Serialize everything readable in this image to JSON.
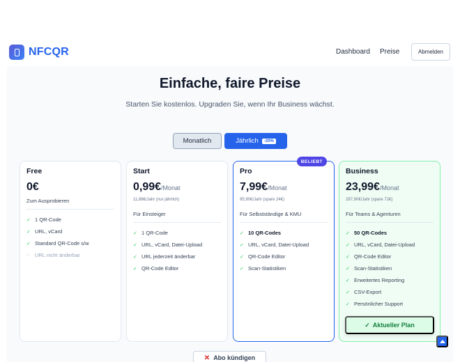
{
  "app": {
    "logo_text": "NFCQR"
  },
  "nav": {
    "dashboard": "Dashboard",
    "preise": "Preise",
    "logout": "Abmelden"
  },
  "hero": {
    "title": "Einfache, faire Preise",
    "subtitle": "Starten Sie kostenlos. Upgraden Sie, wenn Ihr Business wächst."
  },
  "billing": {
    "monthly": "Monatlich",
    "yearly": "Jährlich",
    "discount": "-20%",
    "selected": "yearly"
  },
  "plans": [
    {
      "name": "Free",
      "price": "0€",
      "period": "",
      "yearly_note": "",
      "desc": "Zum Ausprobieren",
      "features": [
        {
          "text": "1 QR-Code",
          "included": true
        },
        {
          "text": "URL, vCard",
          "included": true
        },
        {
          "text": "Standard QR-Code s/w",
          "included": true
        },
        {
          "text": "URL nicht änderbar",
          "included": false
        }
      ]
    },
    {
      "name": "Start",
      "price": "0,99€",
      "period": "/Monat",
      "yearly_note": "11,88€/Jahr (nur jährlich)",
      "desc": "Für Einsteiger",
      "features": [
        {
          "text": "1 QR-Code",
          "included": true
        },
        {
          "text": "URL, vCard, Datei-Upload",
          "included": true
        },
        {
          "text": "URL jederzeit änderbar",
          "included": true
        },
        {
          "text": "QR-Code Editor",
          "included": true
        }
      ]
    },
    {
      "name": "Pro",
      "price": "7,99€",
      "period": "/Monat",
      "yearly_note": "95,90€/Jahr (spare 24€)",
      "desc": "Für Selbstständige & KMU",
      "badge": "BELIEBT",
      "features": [
        {
          "text": "10 QR-Codes",
          "included": true,
          "strong": true
        },
        {
          "text": "URL, vCard, Datei-Upload",
          "included": true
        },
        {
          "text": "QR-Code Editor",
          "included": true
        },
        {
          "text": "Scan-Statistiken",
          "included": true
        }
      ]
    },
    {
      "name": "Business",
      "price": "23,99€",
      "period": "/Monat",
      "yearly_note": "287,90€/Jahr (spare 72€)",
      "desc": "Für Teams & Agenturen",
      "current_plan_label": "Aktueller Plan",
      "features": [
        {
          "text": "50 QR-Codes",
          "included": true,
          "strong": true
        },
        {
          "text": "URL, vCard, Datei-Upload",
          "included": true
        },
        {
          "text": "QR-Code Editor",
          "included": true
        },
        {
          "text": "Scan-Statistiken",
          "included": true
        },
        {
          "text": "Erweitertes Reporting",
          "included": true
        },
        {
          "text": "CSV-Export",
          "included": true
        },
        {
          "text": "Persönlicher Support",
          "included": true
        }
      ]
    }
  ],
  "cancel": {
    "label": "Abo kündigen"
  },
  "colors": {
    "primary": "#2563eb",
    "success": "#22c55e",
    "badge": "#4f46e5",
    "danger": "#dc2626"
  }
}
